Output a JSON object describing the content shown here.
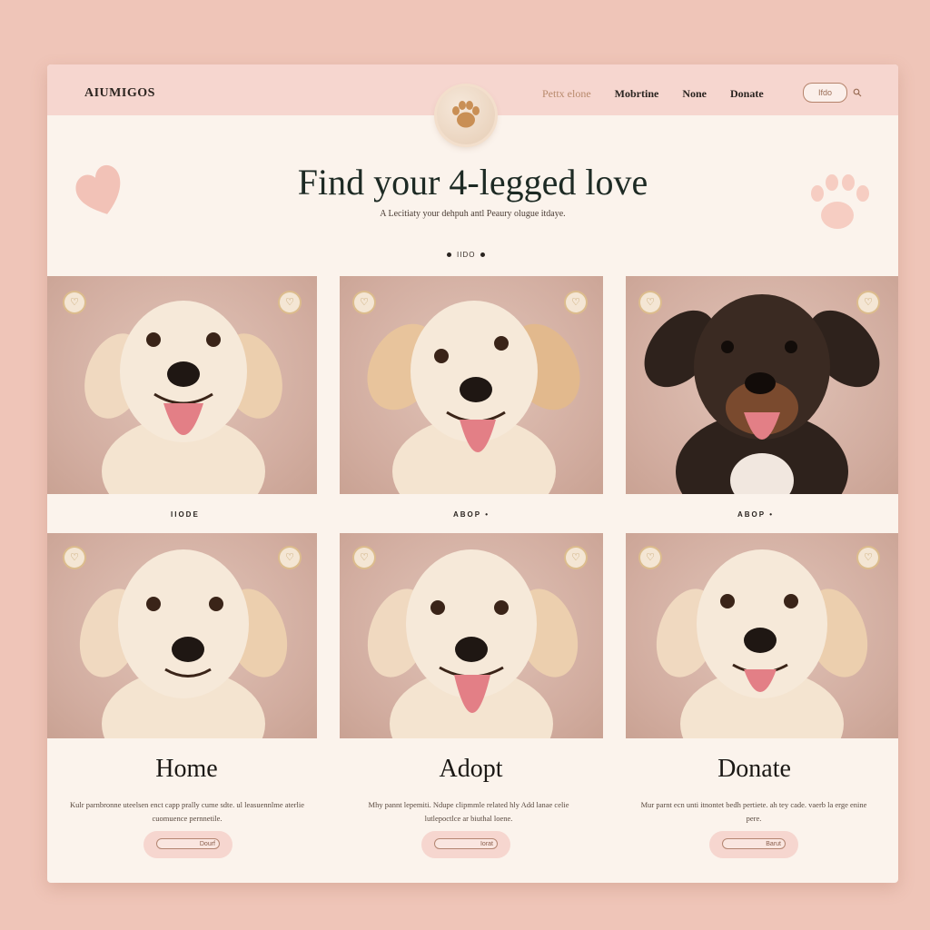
{
  "header": {
    "logo": "AIUMIGOS",
    "nav": [
      "Pettx elone",
      "Mobrtine",
      "None",
      "Donate"
    ],
    "button_label": "Ifdo",
    "icons": [
      "paw-icon",
      "search-icon"
    ]
  },
  "hero": {
    "title": "Find your 4-legged love",
    "subtitle": "A Lecitiaty your dehpuh antl Peaury olugue itdaye.",
    "dots_label": "IIDO"
  },
  "cards": [
    {
      "coat": "cream",
      "caption": "IIODE"
    },
    {
      "coat": "golden",
      "caption": "ABOP •"
    },
    {
      "coat": "black-tan",
      "caption": "ABOP •"
    },
    {
      "coat": "cream"
    },
    {
      "coat": "cream"
    },
    {
      "coat": "cream"
    }
  ],
  "columns": [
    {
      "title": "Home",
      "text": "Kulr parnbronne uteelsen enct capp prally cume sdte. ul leasuennlme aterlie cuomuence pernnetile.",
      "button": "Dourf"
    },
    {
      "title": "Adopt",
      "text": "Mhy pannt lepemiti. Ndupe clipmmle related hly Add lanae celie lutlepoctlce ar biuthal loene.",
      "button": "Iorat"
    },
    {
      "title": "Donate",
      "text": "Mur parnt ecn unti itnontet bedh pertiete. ah tey cade. vaerb la erge enine pere.",
      "button": "Barut"
    }
  ],
  "colors": {
    "background": "#efc5b8",
    "header": "#f6d6cf",
    "page": "#fbf3ec",
    "accent_gold": "#dcbc8d",
    "text_dark": "#1d2a24"
  }
}
